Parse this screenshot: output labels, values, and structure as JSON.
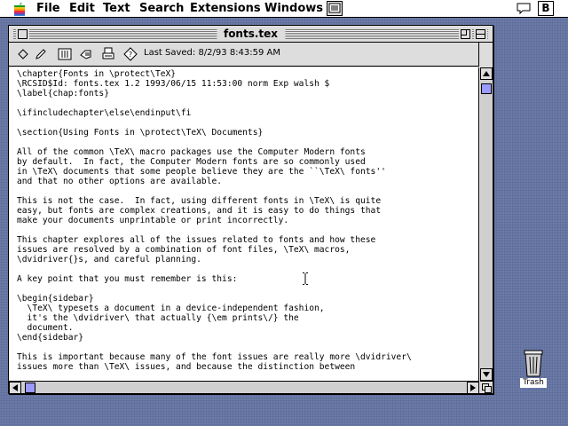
{
  "menubar": {
    "apple_icon": "apple-logo-icon",
    "items": [
      {
        "label": "File"
      },
      {
        "label": "Edit"
      },
      {
        "label": "Text"
      },
      {
        "label": "Search"
      },
      {
        "label": "Extensions"
      },
      {
        "label": "Windows"
      }
    ],
    "app_icon": "application-menu-icon",
    "help_icon": "help-balloon-icon",
    "fe_label": "B"
  },
  "window": {
    "title": "fonts.tex",
    "toolbar": {
      "icons": [
        "diamond-icon",
        "pencil-icon",
        "columns-icon",
        "hand-icon",
        "printer-icon",
        "help-diamond-icon"
      ],
      "last_saved": "Last Saved: 8/2/93 8:43:59 AM"
    },
    "lines": [
      "\\chapter{Fonts in \\protect\\TeX}",
      "\\RCSID$Id: fonts.tex 1.2 1993/06/15 11:53:00 norm Exp walsh $",
      "\\label{chap:fonts}",
      "",
      "\\ifincludechapter\\else\\endinput\\fi",
      "",
      "\\section{Using Fonts in \\protect\\TeX\\ Documents}",
      "",
      "All of the common \\TeX\\ macro packages use the Computer Modern fonts",
      "by default.  In fact, the Computer Modern fonts are so commonly used",
      "in \\TeX\\ documents that some people believe they are the ``\\TeX\\ fonts''",
      "and that no other options are available.",
      "",
      "This is not the case.  In fact, using different fonts in \\TeX\\ is quite",
      "easy, but fonts are complex creations, and it is easy to do things that",
      "make your documents unprintable or print incorrectly.",
      "",
      "This chapter explores all of the issues related to fonts and how these",
      "issues are resolved by a combination of font files, \\TeX\\ macros,",
      "\\dvidriver{}s, and careful planning.",
      "",
      "A key point that you must remember is this:",
      "",
      "\\begin{sidebar}",
      "  \\TeX\\ typesets a document in a device-independent fashion,",
      "  it's the \\dvidriver\\ that actually {\\em prints\\/} the",
      "  document.",
      "\\end{sidebar}",
      "",
      "This is important because many of the font issues are really more \\dvidriver\\",
      "issues more than \\TeX\\ issues, and because the distinction between"
    ]
  },
  "desktop": {
    "trash_label": "Trash"
  }
}
